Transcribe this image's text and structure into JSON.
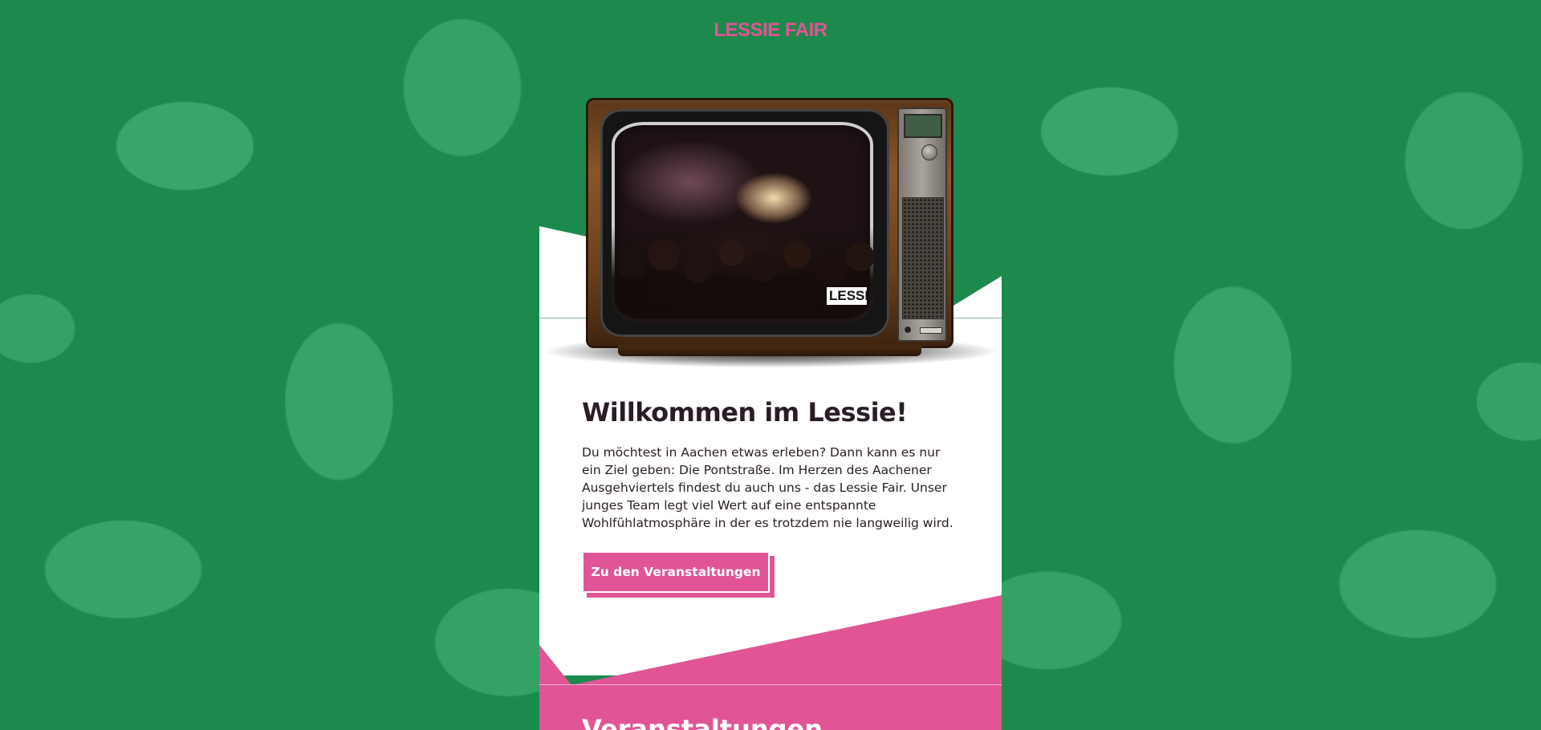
{
  "header": {
    "brand": "LESSIE FAIR"
  },
  "hero": {
    "tv_screen_logo": "LESSIE"
  },
  "welcome": {
    "title": "Willkommen im Lessie!",
    "text": "Du möchtest in Aachen etwas erleben? Dann kann es nur ein Ziel geben: Die Pontstraße. Im Herzen des Aachener Ausgehviertels findest du auch uns - das Lessie Fair. Unser junges Team legt viel Wert auf eine entspannte Wohlfühlatmosphäre in der es trotzdem nie langweilig wird.",
    "cta_label": "Zu den Veranstaltungen"
  },
  "events": {
    "title_partial": "Veranstaltungen"
  },
  "colors": {
    "brand_pink": "#e15596",
    "background_green": "#1c8a4c",
    "text_dark": "#2a1d27"
  }
}
